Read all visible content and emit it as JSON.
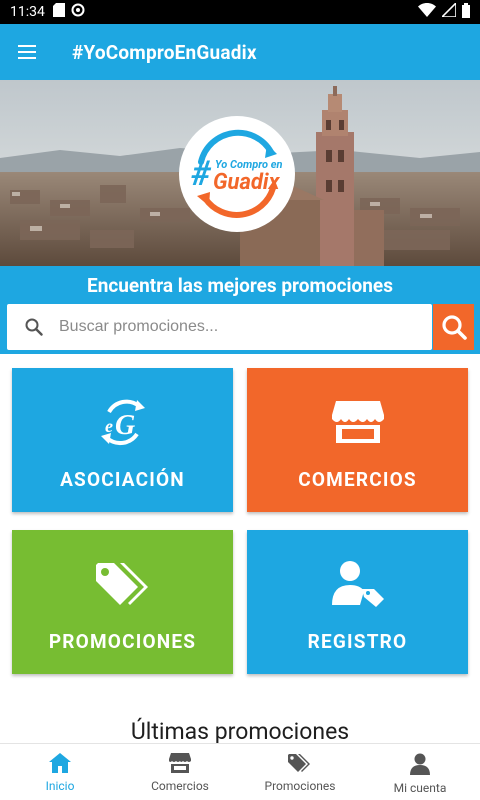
{
  "status": {
    "time": "11:34"
  },
  "appbar": {
    "title": "#YoComproEnGuadix",
    "menu_icon": "hamburger-menu-icon"
  },
  "hero": {
    "logo_line1": "Yo Compro en",
    "logo_line2": "Guadix",
    "logo_hash": "#"
  },
  "search": {
    "heading": "Encuentra las mejores promociones",
    "placeholder": "Buscar promociones..."
  },
  "tiles": [
    {
      "label": "ASOCIACIÓN",
      "icon": "association-logo-icon",
      "color": "#1ea7e1"
    },
    {
      "label": "COMERCIOS",
      "icon": "storefront-icon",
      "color": "#f2672a"
    },
    {
      "label": "PROMOCIONES",
      "icon": "tags-icon",
      "color": "#77bd32"
    },
    {
      "label": "REGISTRO",
      "icon": "user-tag-icon",
      "color": "#1ea7e1"
    }
  ],
  "latest_heading": "Últimas promociones",
  "bottom_nav": [
    {
      "label": "Inicio",
      "icon": "home-icon",
      "active": true
    },
    {
      "label": "Comercios",
      "icon": "store-icon",
      "active": false
    },
    {
      "label": "Promociones",
      "icon": "tags-icon",
      "active": false
    },
    {
      "label": "Mi cuenta",
      "icon": "user-icon",
      "active": false
    }
  ],
  "colors": {
    "primary": "#1ea7e1",
    "accent": "#f2672a",
    "green": "#77bd32"
  }
}
